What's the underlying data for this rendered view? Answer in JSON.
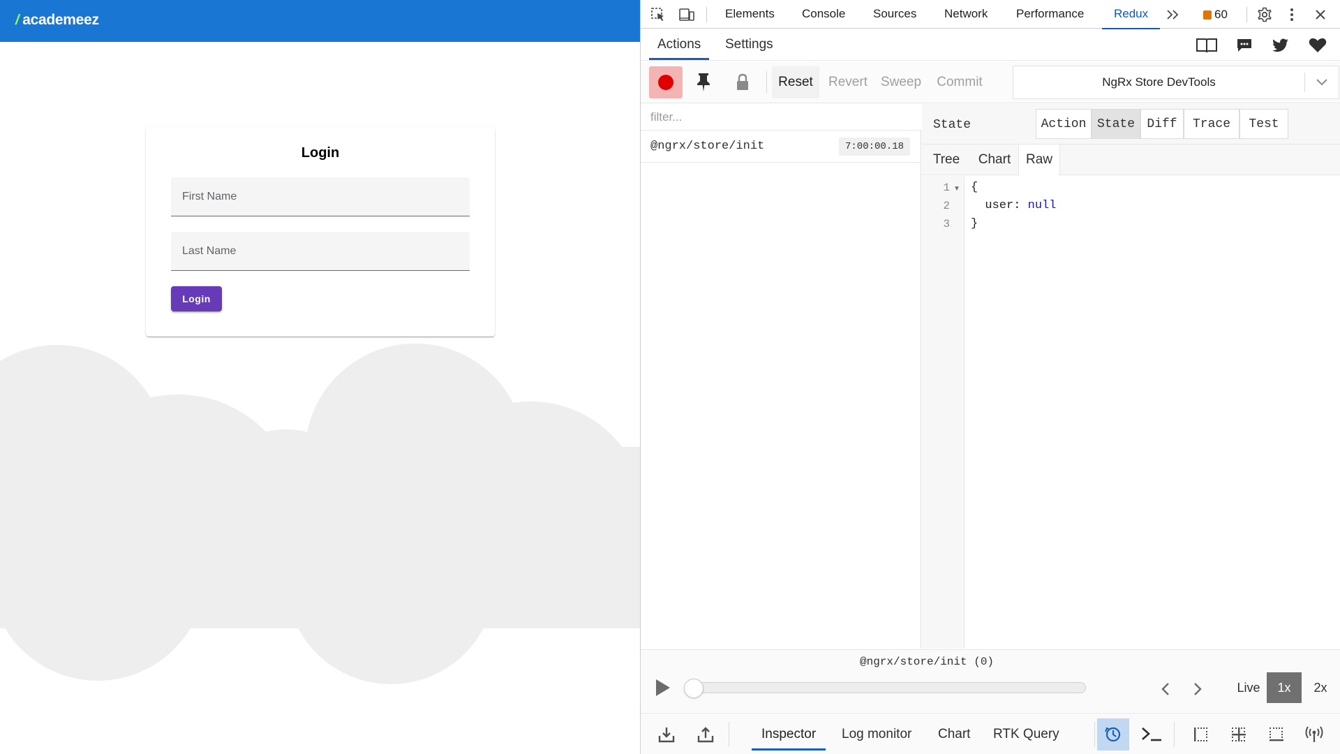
{
  "app": {
    "brand": "academeez",
    "login_card": {
      "title": "Login",
      "first_name_placeholder": "First Name",
      "first_name_value": "",
      "last_name_placeholder": "Last Name",
      "last_name_value": "",
      "submit_label": "Login"
    },
    "colors": {
      "app_bar": "#1976d2",
      "submit_button": "#673ab7",
      "cloud": "#eeeeee"
    }
  },
  "devtools": {
    "tabs": [
      "Elements",
      "Console",
      "Sources",
      "Network",
      "Performance",
      "Redux"
    ],
    "active_tab": "Redux",
    "issues_count": "60",
    "icons": [
      "inspect-element-icon",
      "device-toolbar-icon",
      "more-tabs-icon",
      "issues-flag-icon",
      "settings-gear-icon",
      "kebab-menu-icon",
      "close-icon"
    ],
    "accent": "#0b57d0"
  },
  "redux": {
    "nav_tabs": [
      "Actions",
      "Settings"
    ],
    "nav_icons": [
      "docs-book-icon",
      "feedback-chat-icon",
      "twitter-icon",
      "sponsor-heart-icon"
    ],
    "toolbar": {
      "buttons": [
        "Reset",
        "Revert",
        "Sweep",
        "Commit"
      ],
      "store_selected": "NgRx Store DevTools",
      "icons": [
        "record-icon",
        "pin-icon",
        "lock-icon",
        "chevron-down-icon"
      ]
    },
    "filter_placeholder": "filter...",
    "actions": [
      {
        "name": "@ngrx/store/init",
        "time": "7:00:00.18"
      }
    ],
    "state_panel": {
      "title": "State",
      "segments": [
        "Action",
        "State",
        "Diff",
        "Trace",
        "Test"
      ],
      "active_segment": "State",
      "view_tabs": [
        "Tree",
        "Chart",
        "Raw"
      ],
      "active_view": "Raw",
      "raw_lines": [
        {
          "n": "1",
          "open": "{"
        },
        {
          "n": "2",
          "key": "user:",
          "value": "null"
        },
        {
          "n": "3",
          "close": "}"
        }
      ]
    },
    "slider": {
      "label": "@ngrx/store/init (0)",
      "position": 0,
      "speeds": [
        "Live",
        "1x",
        "2x"
      ],
      "active_speed": "1x"
    },
    "monitors": [
      "Inspector",
      "Log monitor",
      "Chart",
      "RTK Query"
    ],
    "active_monitor": "Inspector",
    "bottom_icons": [
      "import-icon",
      "export-icon",
      "dispatcher-clock-icon",
      "terminal-icon",
      "slider-grid-icon",
      "chart-grid-icon",
      "log-grid-icon",
      "remote-broadcast-icon"
    ]
  }
}
